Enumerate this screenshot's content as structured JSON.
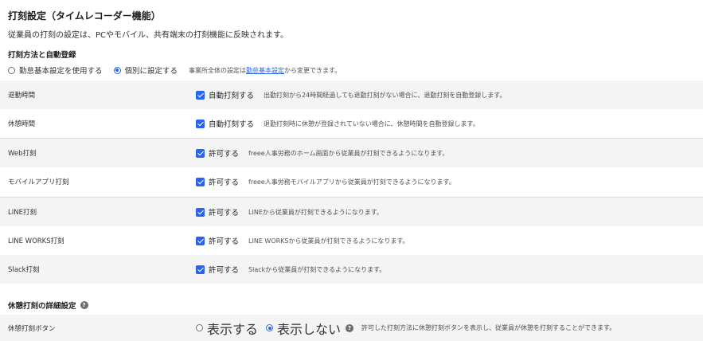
{
  "page_title": "打刻設定（タイムレコーダー機能）",
  "description": "従業員の打刻の設定は、PCやモバイル、共有端末の打刻機能に反映されます。",
  "method_section": {
    "title": "打刻方法と自動登録",
    "options": [
      "勤怠基本設定を使用する",
      "個別に設定する"
    ],
    "selected": "個別に設定する",
    "note_prefix": "事業所全体の設定は",
    "note_link": "勤怠基本設定",
    "note_suffix": "から変更できます。"
  },
  "rows": [
    {
      "label": "退勤時間",
      "checked": true,
      "control_label": "自動打刻する",
      "note": "出勤打刻から24時間経過しても退勤打刻がない場合に、退勤打刻を自動登録します。"
    },
    {
      "label": "休憩時間",
      "checked": true,
      "control_label": "自動打刻する",
      "note": "退勤打刻時に休憩が登録されていない場合に、休憩時間を自動登録します。"
    },
    {
      "label": "Web打刻",
      "checked": true,
      "control_label": "許可する",
      "note": "freee人事労務のホーム画面から従業員が打刻できるようになります。"
    },
    {
      "label": "モバイルアプリ打刻",
      "checked": true,
      "control_label": "許可する",
      "note": "freee人事労務モバイルアプリから従業員が打刻できるようになります。"
    },
    {
      "label": "LINE打刻",
      "checked": true,
      "control_label": "許可する",
      "note": "LINEから従業員が打刻できるようになります。"
    },
    {
      "label": "LINE WORKS打刻",
      "checked": true,
      "control_label": "許可する",
      "note": "LINE WORKSから従業員が打刻できるようになります。"
    },
    {
      "label": "Slack打刻",
      "checked": true,
      "control_label": "許可する",
      "note": "Slackから従業員が打刻できるようになります。"
    }
  ],
  "break_section": {
    "title": "休憩打刻の詳細設定",
    "help_icon": "?",
    "row_label": "休憩打刻ボタン",
    "options": [
      "表示する",
      "表示しない"
    ],
    "selected": "表示しない",
    "note": "許可した打刻方法に休憩打刻ボタンを表示し、従業員が休憩を打刻することができます。"
  },
  "colors": {
    "accent": "#2864f0",
    "row_shade": "#f4f4f4",
    "text": "#323232"
  }
}
